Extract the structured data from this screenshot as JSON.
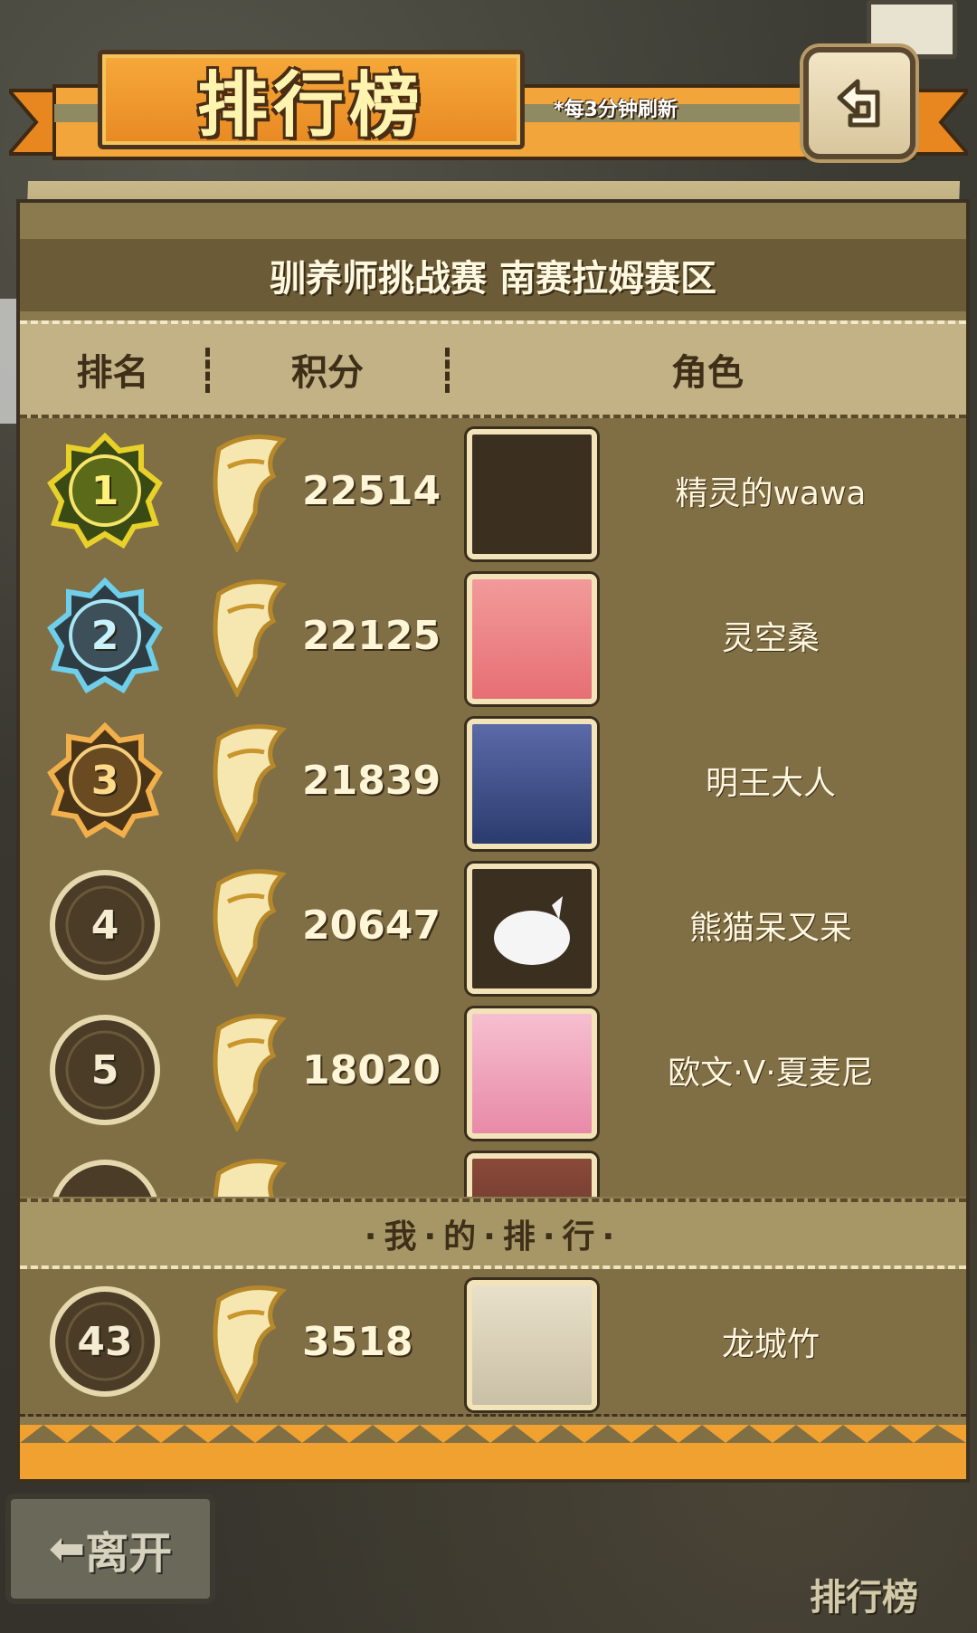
{
  "header": {
    "title": "排行榜",
    "refresh_note": "*每3分钟刷新"
  },
  "panel": {
    "subtitle": "驯养师挑战赛 南赛拉姆赛区",
    "columns": {
      "rank": "排名",
      "score": "积分",
      "role": "角色"
    }
  },
  "leaderboard": [
    {
      "rank": "1",
      "score": "22514",
      "name": "精灵的wawa",
      "badge_color": "#e8d22a"
    },
    {
      "rank": "2",
      "score": "22125",
      "name": "灵空桑",
      "badge_color": "#5fc0e0"
    },
    {
      "rank": "3",
      "score": "21839",
      "name": "明王大人",
      "badge_color": "#f0a040"
    },
    {
      "rank": "4",
      "score": "20647",
      "name": "熊猫呆又呆",
      "badge_color": "#4a3c28"
    },
    {
      "rank": "5",
      "score": "18020",
      "name": "欧文·V·夏麦尼",
      "badge_color": "#4a3c28"
    }
  ],
  "my_ranking": {
    "label": "·我·的·排·行·",
    "rank": "43",
    "score": "3518",
    "name": "龙城竹"
  },
  "footer": {
    "leave_label": "离开",
    "leaderboard_label": "排行榜"
  },
  "icons": {
    "back": "back-arrow-icon",
    "trophy": "winged-trophy-icon",
    "mail": "mail-icon"
  }
}
